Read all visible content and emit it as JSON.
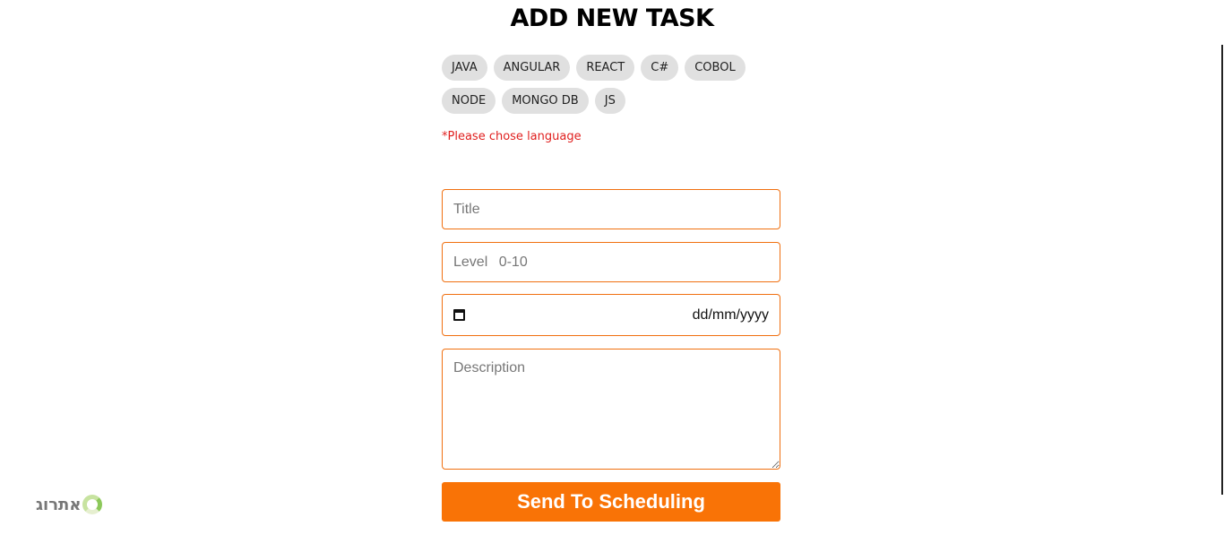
{
  "header": {
    "title": "ADD NEW TASK"
  },
  "languages": [
    "JAVA",
    "ANGULAR",
    "REACT",
    "C#",
    "COBOL",
    "NODE",
    "MONGO DB",
    "JS"
  ],
  "validation": {
    "language_error": "*Please chose language"
  },
  "form": {
    "title_placeholder": "Title",
    "level_placeholder": "Level 0-10",
    "date_placeholder": "dd/mm/yyyy",
    "description_placeholder": "Description",
    "submit_label": "Send To Scheduling"
  },
  "footer": {
    "logo_text": "אתרוג"
  },
  "colors": {
    "accent": "#f97306",
    "field_border": "#f07010",
    "error": "#e0201f",
    "chip_bg": "#e0e0e0"
  }
}
